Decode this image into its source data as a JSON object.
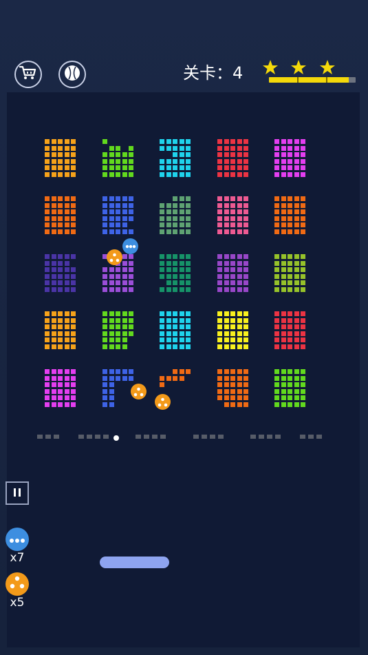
{
  "header": {
    "shop_icon": "cart-icon",
    "ball_icon": "baseball-icon",
    "level_label": "关卡：4",
    "stars": {
      "earned": 3,
      "total": 3,
      "color": "#f4d90a"
    },
    "progress": 0.92
  },
  "board": {
    "background": "#101a35",
    "brick_colors": {
      "orange": "#f6a21a",
      "green": "#62d91e",
      "cyan": "#1fd3ec",
      "red": "#ec3343",
      "magenta": "#e43ef0",
      "deep_orange": "#f06a14",
      "blue": "#3e63e6",
      "sage": "#5ea272",
      "pink": "#ee5a92",
      "indigo": "#4a34a6",
      "violet": "#9b4ed8",
      "teal": "#169368",
      "purple": "#9847c8",
      "olive": "#96c22a",
      "yellow": "#f8f01e"
    },
    "position_marker": {
      "group": 1,
      "slot": 5
    }
  },
  "powerups_on_board": [
    "multi-ball-powerup",
    "split-ball-powerup",
    "split-ball-powerup",
    "split-ball-powerup"
  ],
  "inventory": [
    {
      "name": "multi-ball",
      "icon": "multi-ball-icon",
      "color": "#3d8ee0",
      "count": "x7"
    },
    {
      "name": "split-ball",
      "icon": "split-ball-icon",
      "color": "#f39a1a",
      "count": "x5"
    }
  ],
  "controls": {
    "pause_icon": "pause-icon"
  },
  "paddle": {
    "color": "#8ea4f0"
  }
}
